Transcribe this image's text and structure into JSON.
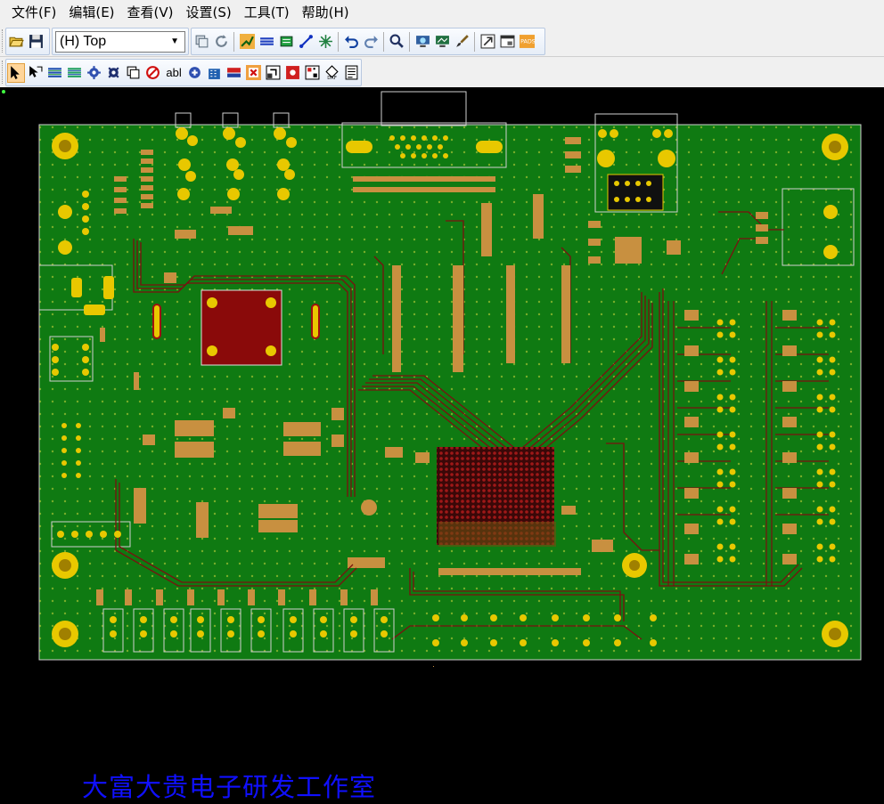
{
  "menu": {
    "items": [
      "文件(F)",
      "编辑(E)",
      "查看(V)",
      "设置(S)",
      "工具(T)",
      "帮助(H)"
    ]
  },
  "toolbar": {
    "layer_select_value": "(H) Top",
    "row1_icons": [
      "open-folder-icon",
      "save-icon",
      "layer-select",
      "layer-pair-icon",
      "redraw-icon",
      "route-icon",
      "pour-icon",
      "component-icon",
      "trace-icon",
      "spark-icon",
      "undo-icon",
      "redo-icon",
      "zoom-icon",
      "view-icon",
      "display-icon",
      "brush-icon",
      "export-icon",
      "window-icon",
      "pads-icon"
    ],
    "row2_icons": [
      "select-arrow-icon",
      "select-segment-icon",
      "layers-icon",
      "layers-alt-icon",
      "gear-icon",
      "gear-alt-icon",
      "copy-icon",
      "no-icon",
      "text-abl-icon",
      "fill-icon",
      "building-icon",
      "swap-icon",
      "delete-icon",
      "import-icon",
      "dxf-icon",
      "qr-icon",
      "dxf-export-icon",
      "report-icon"
    ],
    "row2_text_label": "abl"
  },
  "canvas": {
    "caption": "大富大贵电子研发工作室",
    "board_color": "#0f7a12",
    "trace_color": "#7a1010",
    "pad_color": "#e8c800",
    "outline_color": "#d0d0d0"
  }
}
